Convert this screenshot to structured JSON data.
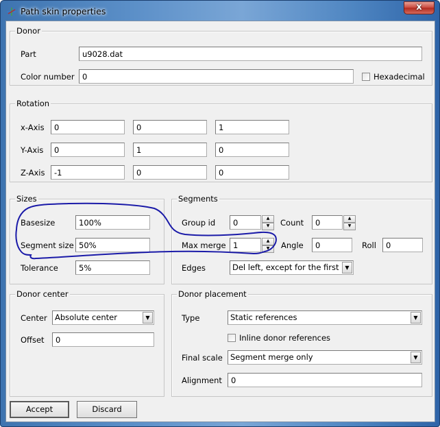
{
  "window": {
    "title": "Path skin properties",
    "close_label": "x",
    "icon": "app-path-icon"
  },
  "donor": {
    "group_label": "Donor",
    "part_label": "Part",
    "part_value": "u9028.dat",
    "color_label": "Color number",
    "color_value": "0",
    "hexadecimal_label": "Hexadecimal",
    "hexadecimal_checked": false
  },
  "rotation": {
    "group_label": "Rotation",
    "rows": [
      {
        "label": "x-Axis",
        "values": [
          "0",
          "0",
          "1"
        ]
      },
      {
        "label": "Y-Axis",
        "values": [
          "0",
          "1",
          "0"
        ]
      },
      {
        "label": "Z-Axis",
        "values": [
          "-1",
          "0",
          "0"
        ]
      }
    ]
  },
  "sizes": {
    "group_label": "Sizes",
    "basesize_label": "Basesize",
    "basesize_value": "100%",
    "segment_size_label": "Segment size",
    "segment_size_value": "50%",
    "tolerance_label": "Tolerance",
    "tolerance_value": "5%"
  },
  "segments": {
    "group_label": "Segments",
    "group_id_label": "Group id",
    "group_id_value": "0",
    "count_label": "Count",
    "count_value": "0",
    "max_merge_label": "Max merge",
    "max_merge_value": "1",
    "angle_label": "Angle",
    "angle_value": "0",
    "roll_label": "Roll",
    "roll_value": "0",
    "edges_label": "Edges",
    "edges_value": "Del left, except for the first"
  },
  "donor_center": {
    "group_label": "Donor center",
    "center_label": "Center",
    "center_value": "Absolute center",
    "offset_label": "Offset",
    "offset_value": "0"
  },
  "donor_placement": {
    "group_label": "Donor placement",
    "type_label": "Type",
    "type_value": "Static references",
    "inline_label": "Inline donor references",
    "inline_checked": false,
    "final_scale_label": "Final scale",
    "final_scale_value": "Segment merge only",
    "alignment_label": "Alignment",
    "alignment_value": "0"
  },
  "buttons": {
    "accept_label": "Accept",
    "discard_label": "Discard"
  },
  "annotation": {
    "color": "#1a1aa8",
    "description": "hand-drawn blue outline around Basesize, Segment size and Max merge"
  }
}
